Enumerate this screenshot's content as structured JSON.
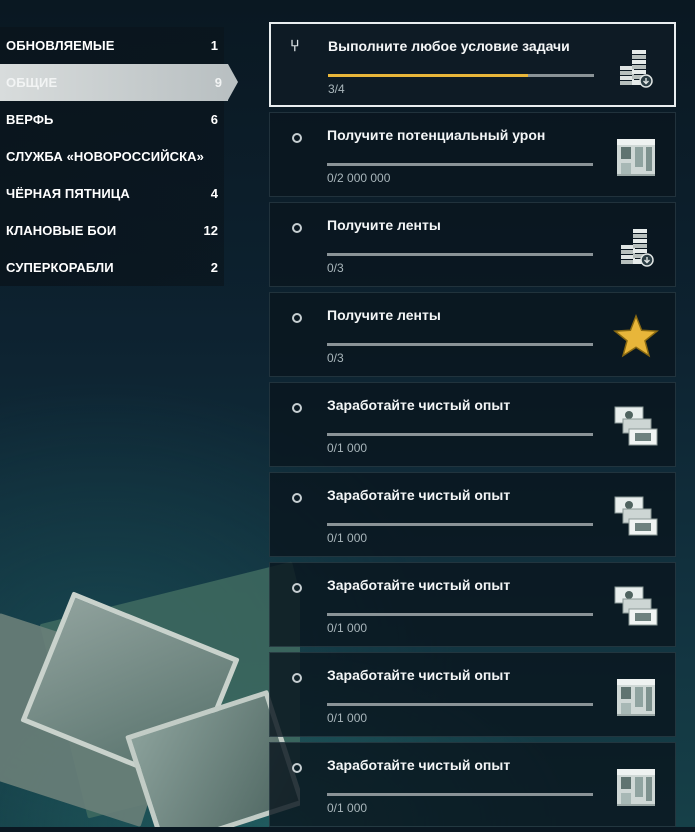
{
  "categories": [
    {
      "label": "ОБНОВЛЯЕМЫЕ",
      "count": "1",
      "active": false
    },
    {
      "label": "ОБЩИЕ",
      "count": "9",
      "active": true
    },
    {
      "label": "ВЕРФЬ",
      "count": "6",
      "active": false
    },
    {
      "label": "СЛУЖБА «НОВОРОССИЙСКА»",
      "count": "",
      "active": false
    },
    {
      "label": "ЧЁРНАЯ ПЯТНИЦА",
      "count": "4",
      "active": false
    },
    {
      "label": "КЛАНОВЫЕ БОИ",
      "count": "12",
      "active": false
    },
    {
      "label": "СУПЕРКОРАБЛИ",
      "count": "2",
      "active": false
    }
  ],
  "tasks": [
    {
      "title": "Выполните любое условие задачи",
      "progress": "3/4",
      "fraction": 0.75,
      "icon": "credits-stack-icon",
      "selected": true
    },
    {
      "title": "Получите потенциальный урон",
      "progress": "0/2 000 000",
      "fraction": 0,
      "icon": "container-icon",
      "selected": false
    },
    {
      "title": "Получите ленты",
      "progress": "0/3",
      "fraction": 0,
      "icon": "credits-stack-icon",
      "selected": false
    },
    {
      "title": "Получите ленты",
      "progress": "0/3",
      "fraction": 0,
      "icon": "star-icon",
      "selected": false
    },
    {
      "title": "Заработайте чистый опыт",
      "progress": "0/1 000",
      "fraction": 0,
      "icon": "banknotes-icon",
      "selected": false
    },
    {
      "title": "Заработайте чистый опыт",
      "progress": "0/1 000",
      "fraction": 0,
      "icon": "banknotes-icon",
      "selected": false
    },
    {
      "title": "Заработайте чистый опыт",
      "progress": "0/1 000",
      "fraction": 0,
      "icon": "banknotes-icon",
      "selected": false
    },
    {
      "title": "Заработайте чистый опыт",
      "progress": "0/1 000",
      "fraction": 0,
      "icon": "container-icon",
      "selected": false
    },
    {
      "title": "Заработайте чистый опыт",
      "progress": "0/1 000",
      "fraction": 0,
      "icon": "container-icon",
      "selected": false
    }
  ],
  "colors": {
    "progress_fill": "#e8b63a",
    "active_tab": "#c9cfd1",
    "star": "#e8b63a"
  }
}
